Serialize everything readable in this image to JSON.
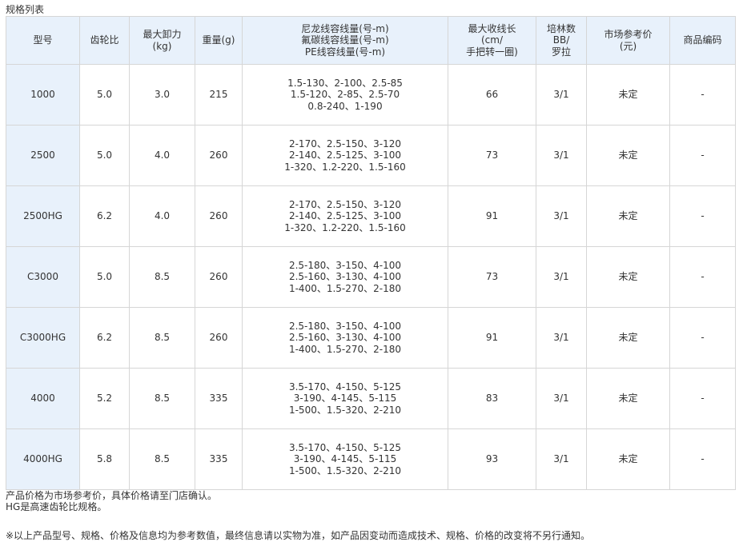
{
  "section_title": "规格列表",
  "headers": {
    "model": "型号",
    "gear_ratio": "齿轮比",
    "max_drag": [
      "最大卸力",
      "(kg)"
    ],
    "weight": "重量(g)",
    "line_capacity": [
      "尼龙线容线量(号-m)",
      "氟碳线容线量(号-m)",
      "PE线容线量(号-m)"
    ],
    "retrieve": [
      "最大收线长",
      "(cm/",
      "手把转一圈)"
    ],
    "bearings": [
      "培林数",
      "BB/",
      "罗拉"
    ],
    "price": [
      "市场参考价",
      "(元)"
    ],
    "product_code": "商品编码"
  },
  "rows": [
    {
      "model": "1000",
      "gear_ratio": "5.0",
      "max_drag": "3.0",
      "weight": "215",
      "line_capacity": [
        "1.5-130、2-100、2.5-85",
        "1.5-120、2-85、2.5-70",
        "0.8-240、1-190"
      ],
      "retrieve": "66",
      "bearings": "3/1",
      "price": "未定",
      "product_code": "-"
    },
    {
      "model": "2500",
      "gear_ratio": "5.0",
      "max_drag": "4.0",
      "weight": "260",
      "line_capacity": [
        "2-170、2.5-150、3-120",
        "2-140、2.5-125、3-100",
        "1-320、1.2-220、1.5-160"
      ],
      "retrieve": "73",
      "bearings": "3/1",
      "price": "未定",
      "product_code": "-"
    },
    {
      "model": "2500HG",
      "gear_ratio": "6.2",
      "max_drag": "4.0",
      "weight": "260",
      "line_capacity": [
        "2-170、2.5-150、3-120",
        "2-140、2.5-125、3-100",
        "1-320、1.2-220、1.5-160"
      ],
      "retrieve": "91",
      "bearings": "3/1",
      "price": "未定",
      "product_code": "-"
    },
    {
      "model": "C3000",
      "gear_ratio": "5.0",
      "max_drag": "8.5",
      "weight": "260",
      "line_capacity": [
        "2.5-180、3-150、4-100",
        "2.5-160、3-130、4-100",
        "1-400、1.5-270、2-180"
      ],
      "retrieve": "73",
      "bearings": "3/1",
      "price": "未定",
      "product_code": "-"
    },
    {
      "model": "C3000HG",
      "gear_ratio": "6.2",
      "max_drag": "8.5",
      "weight": "260",
      "line_capacity": [
        "2.5-180、3-150、4-100",
        "2.5-160、3-130、4-100",
        "1-400、1.5-270、2-180"
      ],
      "retrieve": "91",
      "bearings": "3/1",
      "price": "未定",
      "product_code": "-"
    },
    {
      "model": "4000",
      "gear_ratio": "5.2",
      "max_drag": "8.5",
      "weight": "335",
      "line_capacity": [
        "3.5-170、4-150、5-125",
        "3-190、4-145、5-115",
        "1-500、1.5-320、2-210"
      ],
      "retrieve": "83",
      "bearings": "3/1",
      "price": "未定",
      "product_code": "-"
    },
    {
      "model": "4000HG",
      "gear_ratio": "5.8",
      "max_drag": "8.5",
      "weight": "335",
      "line_capacity": [
        "3.5-170、4-150、5-125",
        "3-190、4-145、5-115",
        "1-500、1.5-320、2-210"
      ],
      "retrieve": "93",
      "bearings": "3/1",
      "price": "未定",
      "product_code": "-"
    }
  ],
  "notes": [
    "产品价格为市场参考价，具体价格请至门店确认。",
    "HG是高速齿轮比规格。"
  ],
  "disclaimer": "※以上产品型号、规格、价格及信息均为参考数值，最终信息请以实物为准，如产品因变动而造成技术、规格、价格的改变将不另行通知。",
  "colors": {
    "header_bg": "#e8f1fb",
    "model_col_bg": "#e8f1fb",
    "border": "#d6d6d6",
    "text": "#333333"
  }
}
